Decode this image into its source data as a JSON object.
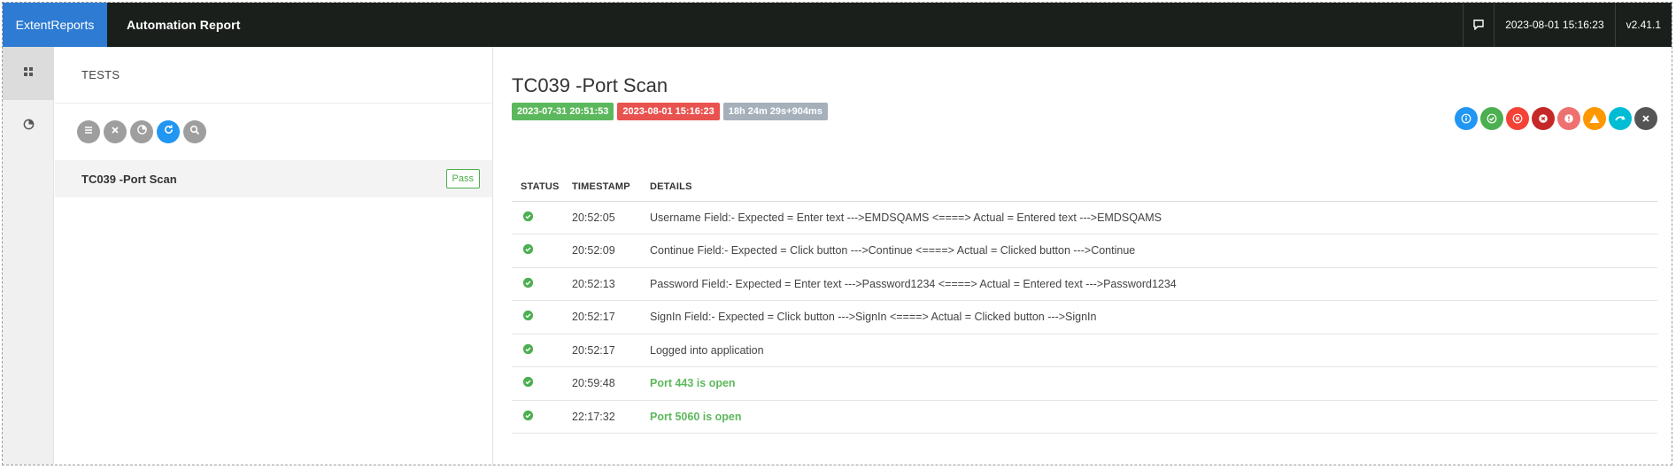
{
  "navbar": {
    "brand": "ExtentReports",
    "report_name": "Automation Report",
    "datetime": "2023-08-01 15:16:23",
    "version": "v2.41.1",
    "icon": "comment-icon"
  },
  "rail": {
    "items": [
      {
        "icon": "dashboard-icon"
      },
      {
        "icon": "pie-chart-icon"
      }
    ]
  },
  "list": {
    "heading": "TESTS",
    "filters": [
      "list-icon",
      "close-icon",
      "pie-icon",
      "refresh-icon",
      "search-icon"
    ],
    "tests": [
      {
        "name": "TC039 -Port Scan",
        "status": "Pass"
      }
    ]
  },
  "detail": {
    "title": "TC039 -Port Scan",
    "start": "2023-07-31 20:51:53",
    "end": "2023-08-01 15:16:23",
    "duration": "18h 24m 29s+904ms",
    "status_icons": [
      {
        "name": "info-icon",
        "color": "#2196f3"
      },
      {
        "name": "pass-icon",
        "color": "#4caf50"
      },
      {
        "name": "fail-icon",
        "color": "#f44336"
      },
      {
        "name": "fatal-icon",
        "color": "#c62828"
      },
      {
        "name": "error-icon",
        "color": "#ef7070"
      },
      {
        "name": "warning-icon",
        "color": "#ff9800"
      },
      {
        "name": "skip-icon",
        "color": "#00bcd4"
      },
      {
        "name": "clear-icon",
        "color": "#555555"
      }
    ],
    "table": {
      "headers": [
        "STATUS",
        "TIMESTAMP",
        "DETAILS"
      ],
      "rows": [
        {
          "time": "20:52:05",
          "details": "Username Field:- Expected = Enter text --->EMDSQAMS <====> Actual = Entered text --->EMDSQAMS"
        },
        {
          "time": "20:52:09",
          "details": "Continue Field:- Expected = Click button --->Continue <====> Actual = Clicked button --->Continue"
        },
        {
          "time": "20:52:13",
          "details": "Password Field:- Expected = Enter text --->Password1234 <====> Actual = Entered text --->Password1234"
        },
        {
          "time": "20:52:17",
          "details": "SignIn Field:- Expected = Click button --->SignIn <====> Actual = Clicked button --->SignIn"
        },
        {
          "time": "20:52:17",
          "details": "Logged into application"
        },
        {
          "time": "20:59:48",
          "details": "Port 443 is open"
        },
        {
          "time": "22:17:32",
          "details": "Port 5060 is open"
        }
      ]
    }
  },
  "colors": {
    "brand_blue": "#2d7bd2",
    "navbar_bg": "#1a1f1c",
    "pass_green": "#5cb85c"
  }
}
